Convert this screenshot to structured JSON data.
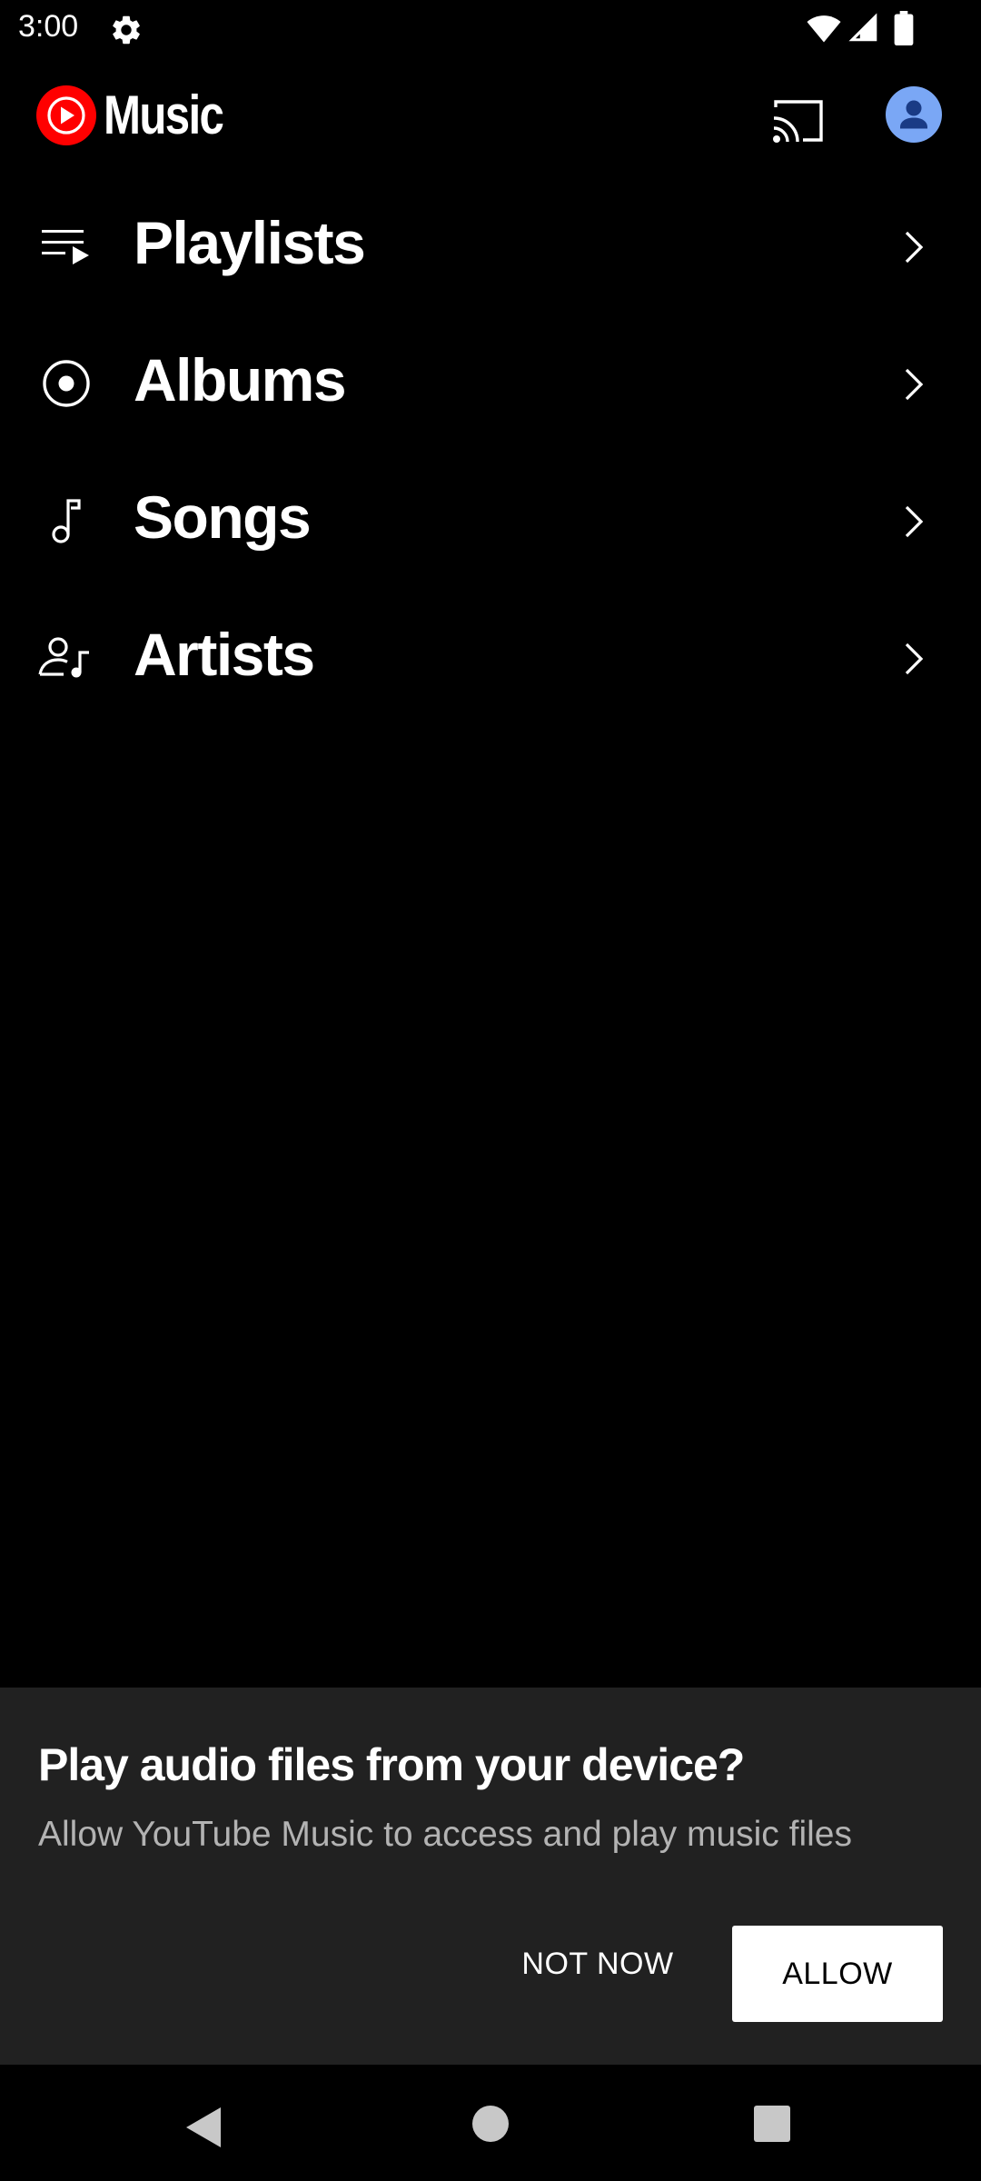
{
  "status_bar": {
    "time": "3:00",
    "icons": [
      "gear-icon",
      "wifi-icon",
      "signal-icon",
      "battery-icon"
    ]
  },
  "app_bar": {
    "logo_text": "Music",
    "logo_icon": "youtube-music-logo-icon",
    "actions": [
      "cast-icon",
      "account-avatar-icon"
    ]
  },
  "library": {
    "items": [
      {
        "label": "Playlists",
        "icon": "playlist-icon"
      },
      {
        "label": "Albums",
        "icon": "album-icon"
      },
      {
        "label": "Songs",
        "icon": "music-note-icon"
      },
      {
        "label": "Artists",
        "icon": "artist-icon"
      }
    ]
  },
  "permission_sheet": {
    "title": "Play audio files from your device?",
    "body": "Allow YouTube Music to access and play music files",
    "not_now_label": "NOT NOW",
    "allow_label": "ALLOW"
  },
  "nav_bar": {
    "buttons": [
      "back-icon",
      "home-icon",
      "recents-icon"
    ]
  },
  "colors": {
    "background": "#000000",
    "brand_red": "#ff0000",
    "sheet_background": "#212121",
    "secondary_text": "#b3b3b3",
    "avatar_background": "#7aa7f5"
  }
}
